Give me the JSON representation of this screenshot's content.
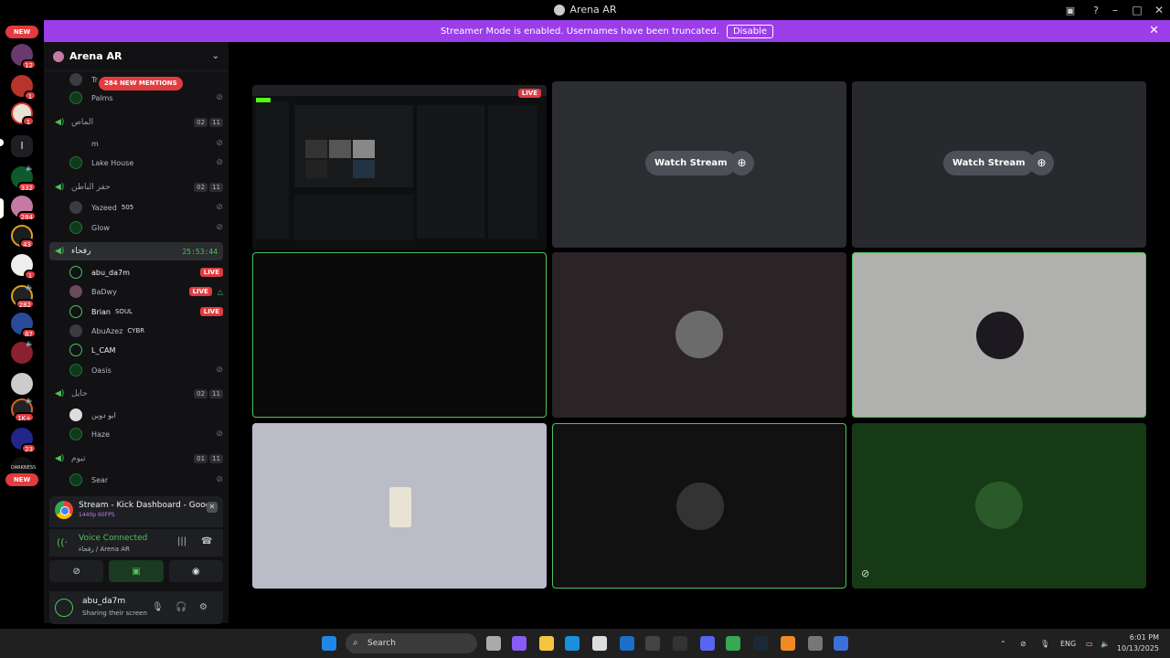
{
  "window": {
    "title": "Arena AR"
  },
  "banner": {
    "text": "Streamer Mode is enabled. Usernames have been truncated.",
    "button": "Disable"
  },
  "guilds": {
    "new_label": "NEW",
    "badges": [
      "12",
      "1",
      "1",
      "332",
      "284",
      "43",
      "1",
      "282",
      "87",
      "1K+",
      "23"
    ],
    "letter": "l",
    "darkness": "DARKNESS"
  },
  "sidebar": {
    "server_name": "Arena AR",
    "mentions": "284 NEW MENTIONS",
    "channels": [
      {
        "name": "الماص",
        "count_a": "02",
        "count_b": "11"
      },
      {
        "name": "حفر الباطن",
        "count_a": "02",
        "count_b": "11"
      },
      {
        "name": "رفحاء",
        "timer": "25:53:44"
      },
      {
        "name": "حايل",
        "count_a": "02",
        "count_b": "11"
      },
      {
        "name": "تيوم",
        "count_a": "01",
        "count_b": "11"
      }
    ],
    "users": {
      "top_a": "Tr",
      "palms": "Palms",
      "m": "m",
      "lake": "Lake House",
      "yazeed": "Yazeed",
      "yazeed_tag": "505",
      "glow": "Glow",
      "abu": "abu_da7m",
      "badwy": "BaDwy",
      "brian": "Brian",
      "brian_tag": "SOUL",
      "abuazez": "AbuAzez",
      "abuazez_tag": "CYBR",
      "lcam": "L_CAM",
      "oasis": "Oasis",
      "abuduin": "ابو دوين",
      "haze": "Haze",
      "sear": "Sear",
      "live": "LIVE"
    }
  },
  "stream_card": {
    "title": "Stream - Kick Dashboard - Google C...",
    "quality": "1440p 60FPS"
  },
  "voice": {
    "status": "Voice Connected",
    "location": "رفحاء / Arena AR"
  },
  "me": {
    "name": "abu_da7m",
    "status": "Sharing their screen"
  },
  "stage": {
    "watch_label": "Watch Stream",
    "live": "LIVE"
  },
  "taskbar": {
    "search": "Search",
    "lang": "ENG",
    "time": "6:01 PM",
    "date": "10/13/2025"
  }
}
